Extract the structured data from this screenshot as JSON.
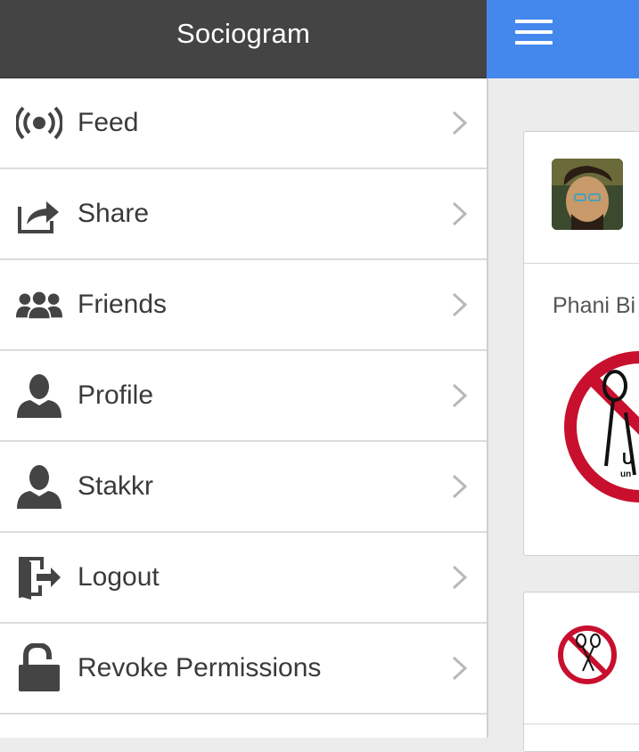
{
  "app": {
    "title": "Sociogram",
    "accent_color": "#4488ee",
    "header_color": "#444444"
  },
  "menu": {
    "items": [
      {
        "label": "Feed",
        "icon": "broadcast-icon"
      },
      {
        "label": "Share",
        "icon": "share-icon"
      },
      {
        "label": "Friends",
        "icon": "friends-icon"
      },
      {
        "label": "Profile",
        "icon": "person-icon"
      },
      {
        "label": "Stakkr",
        "icon": "person-icon"
      },
      {
        "label": "Logout",
        "icon": "logout-door-icon"
      },
      {
        "label": "Revoke Permissions",
        "icon": "unlock-icon"
      }
    ]
  },
  "feed": {
    "post_author": "Phani Bi"
  }
}
